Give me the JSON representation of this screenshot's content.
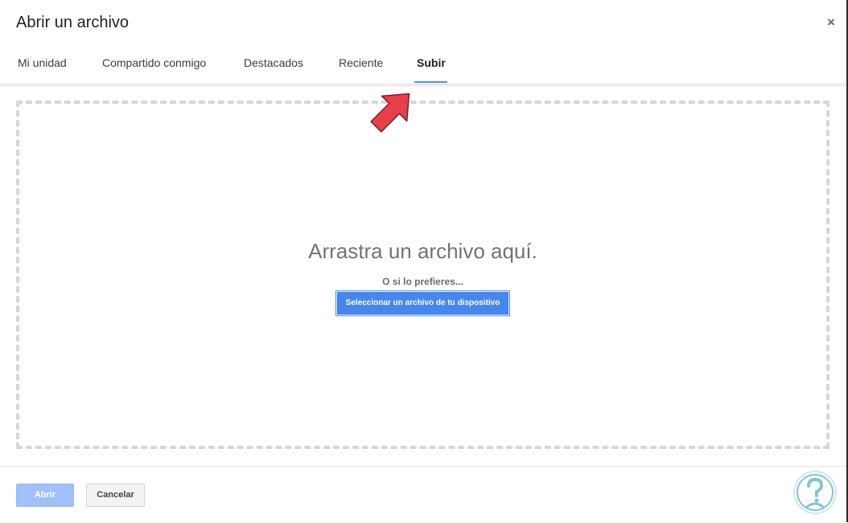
{
  "dialog": {
    "title": "Abrir un archivo",
    "close_label": "×"
  },
  "tabs": [
    {
      "label": "Mi unidad",
      "active": false
    },
    {
      "label": "Compartido conmigo",
      "active": false
    },
    {
      "label": "Destacados",
      "active": false
    },
    {
      "label": "Reciente",
      "active": false
    },
    {
      "label": "Subir",
      "active": true
    }
  ],
  "upload": {
    "drop_title": "Arrastra un archivo aquí.",
    "or_text": "O si lo prefieres...",
    "select_button": "Seleccionar un archivo de tu dispositivo"
  },
  "footer": {
    "open_label": "Abrir",
    "open_disabled": true,
    "cancel_label": "Cancelar"
  },
  "colors": {
    "accent": "#4d90fe",
    "primary_button": "#4787ed",
    "disabled_button": "#a0c0f9",
    "annotation_arrow": "#e8404a",
    "logo": "#7fc6d4"
  },
  "icons": {
    "close": "close-icon",
    "arrow": "pointer-arrow-annotation",
    "logo": "question-person-logo"
  }
}
